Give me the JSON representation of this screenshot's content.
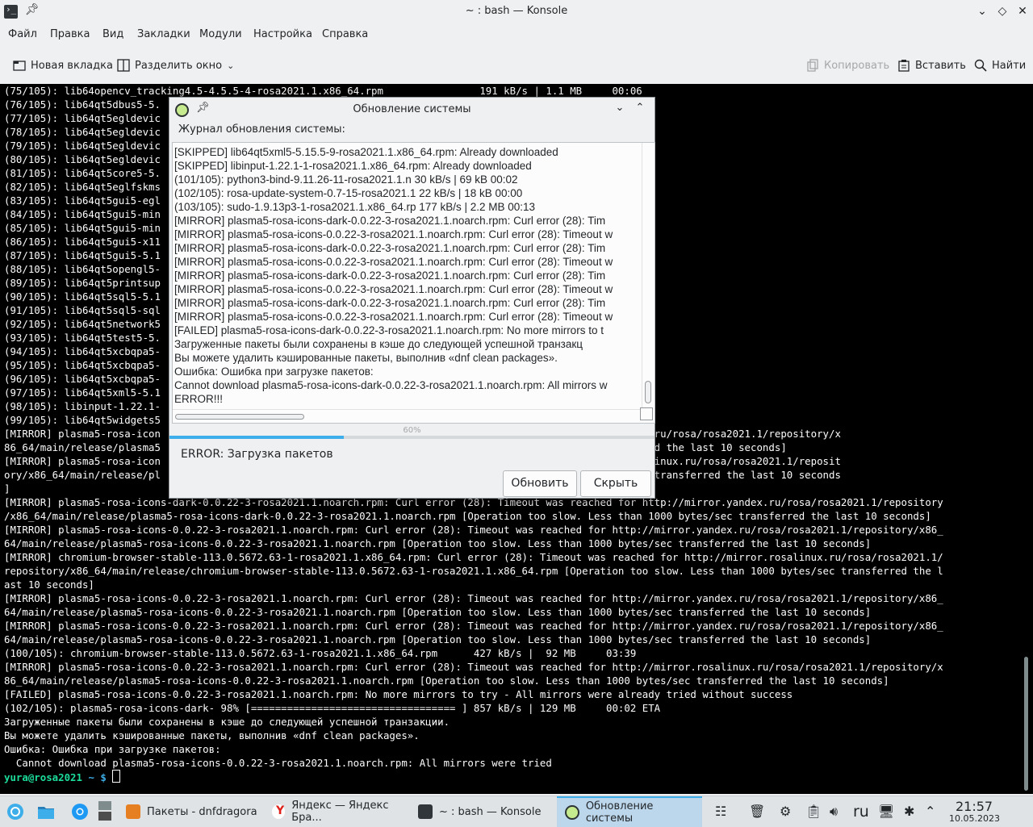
{
  "window": {
    "title": "~ : bash — Konsole",
    "menu": [
      "Файл",
      "Правка",
      "Вид",
      "Закладки",
      "Модули",
      "Настройка",
      "Справка"
    ],
    "toolbar": {
      "new_tab": "Новая вкладка",
      "split": "Разделить окно",
      "copy": "Копировать",
      "paste": "Вставить",
      "find": "Найти"
    }
  },
  "terminal": {
    "lines": [
      "(75/105): lib64opencv_tracking4.5-4.5.5-4-rosa2021.1.x86_64.rpm                191 kB/s | 1.1 MB     00:06",
      "(76/105): lib64qt5dbus5-5.                                                                            00:00",
      "(77/105): lib64qt5egldevic                                                                            00:01",
      "(78/105): lib64qt5egldevic                                                                            00:00",
      "(79/105): lib64qt5egldevic                                                                            00:00",
      "(80/105): lib64qt5egldevic                                                                            00:00",
      "(81/105): lib64qt5core5-5.                                                                            00:04",
      "(82/105): lib64qt5eglfskms                                                                            00:01",
      "(83/105): lib64qt5gui5-egl                                                                            00:00",
      "(84/105): lib64qt5gui5-min                                                                            00:01",
      "(85/105): lib64qt5gui5-min                                                                            00:01",
      "(86/105): lib64qt5gui5-x11                                                                            00:01",
      "(87/105): lib64qt5gui5-5.1                                                                            00:07",
      "(88/105): lib64qt5opengl5-                                                                            00:01",
      "(89/105): lib64qt5printsup                                                                            00:02",
      "(90/105): lib64qt5sql5-5.1                                                                            00:01",
      "(91/105): lib64qt5sql5-sql                                                                            00:00",
      "(92/105): lib64qt5network5                                                                            00:08",
      "(93/105): lib64qt5test5-5.                                                                            00:01",
      "(94/105): lib64qt5xcbqpa5-                                                                            00:02",
      "(95/105): lib64qt5xcbqpa5-                                                                            00:00",
      "(96/105): lib64qt5xcbqpa5-                                                                            00:00",
      "(97/105): lib64qt5xml5-5.1                                                                            00:01",
      "(98/105): libinput-1.22.1-                                                                            00:02",
      "(99/105): lib64qt5widgets5                                                                            00:08",
      "[MIRROR] plasma5-rosa-icon                                                          http://mirror.rosalinux.ru/rosa/rosa2021.1/repository/x",
      "86_64/main/release/plasma5                                                          000 bytes/sec transferred the last 10 seconds]",
      "[MIRROR] plasma5-rosa-icon                                                           for http://mirror.rosalinux.ru/rosa/rosa2021.1/reposit",
      "ory/x86_64/main/release/pl                                                          ess than 1000 bytes/sec transferred the last 10 seconds",
      "]",
      "[MIRROR] plasma5-rosa-icons-dark-0.0.22-3-rosa2021.1.noarch.rpm: Curl error (28): Timeout was reached for http://mirror.yandex.ru/rosa/rosa2021.1/repository",
      "/x86_64/main/release/plasma5-rosa-icons-dark-0.0.22-3-rosa2021.1.noarch.rpm [Operation too slow. Less than 1000 bytes/sec transferred the last 10 seconds]",
      "[MIRROR] plasma5-rosa-icons-0.0.22-3-rosa2021.1.noarch.rpm: Curl error (28): Timeout was reached for http://mirror.yandex.ru/rosa/rosa2021.1/repository/x86_",
      "64/main/release/plasma5-rosa-icons-0.0.22-3-rosa2021.1.noarch.rpm [Operation too slow. Less than 1000 bytes/sec transferred the last 10 seconds]",
      "[MIRROR] chromium-browser-stable-113.0.5672.63-1-rosa2021.1.x86_64.rpm: Curl error (28): Timeout was reached for http://mirror.rosalinux.ru/rosa/rosa2021.1/",
      "repository/x86_64/main/release/chromium-browser-stable-113.0.5672.63-1-rosa2021.1.x86_64.rpm [Operation too slow. Less than 1000 bytes/sec transferred the l",
      "ast 10 seconds]",
      "[MIRROR] plasma5-rosa-icons-0.0.22-3-rosa2021.1.noarch.rpm: Curl error (28): Timeout was reached for http://mirror.yandex.ru/rosa/rosa2021.1/repository/x86_",
      "64/main/release/plasma5-rosa-icons-0.0.22-3-rosa2021.1.noarch.rpm [Operation too slow. Less than 1000 bytes/sec transferred the last 10 seconds]",
      "[MIRROR] plasma5-rosa-icons-0.0.22-3-rosa2021.1.noarch.rpm: Curl error (28): Timeout was reached for http://mirror.yandex.ru/rosa/rosa2021.1/repository/x86_",
      "64/main/release/plasma5-rosa-icons-0.0.22-3-rosa2021.1.noarch.rpm [Operation too slow. Less than 1000 bytes/sec transferred the last 10 seconds]",
      "(100/105): chromium-browser-stable-113.0.5672.63-1-rosa2021.1.x86_64.rpm      427 kB/s |  92 MB     03:39",
      "[MIRROR] plasma5-rosa-icons-0.0.22-3-rosa2021.1.noarch.rpm: Curl error (28): Timeout was reached for http://mirror.rosalinux.ru/rosa/rosa2021.1/repository/x",
      "86_64/main/release/plasma5-rosa-icons-0.0.22-3-rosa2021.1.noarch.rpm [Operation too slow. Less than 1000 bytes/sec transferred the last 10 seconds]",
      "[FAILED] plasma5-rosa-icons-0.0.22-3-rosa2021.1.noarch.rpm: No more mirrors to try - All mirrors were already tried without success",
      "(102/105): plasma5-rosa-icons-dark- 98% [================================== ] 857 kB/s | 129 MB     00:02 ETA",
      "Загруженные пакеты были сохранены в кэше до следующей успешной транзакции.",
      "Вы можете удалить кэшированные пакеты, выполнив «dnf clean packages».",
      "Ошибка: Ошибка при загрузке пакетов:",
      "  Cannot download plasma5-rosa-icons-0.0.22-3-rosa2021.1.noarch.rpm: All mirrors were tried"
    ],
    "prompt_user": "yura@rosa2021",
    "prompt_path": " ~ ",
    "prompt_sym": "$ "
  },
  "dialog": {
    "title": "Обновление системы",
    "log_label": "Журнал обновления системы:",
    "log_lines": [
      "[SKIPPED] lib64qt5xml5-5.15.5-9-rosa2021.1.x86_64.rpm: Already downloaded",
      "[SKIPPED] libinput-1.22.1-1-rosa2021.1.x86_64.rpm: Already downloaded",
      "(101/105): python3-bind-9.11.26-11-rosa2021.1.n  30 kB/s |  69 kB     00:02",
      "(102/105): rosa-update-system-0.7-15-rosa2021.1  22 kB/s |  18 kB     00:00",
      "(103/105): sudo-1.9.13p3-1-rosa2021.1.x86_64.rp 177 kB/s | 2.2 MB     00:13",
      "[MIRROR] plasma5-rosa-icons-dark-0.0.22-3-rosa2021.1.noarch.rpm: Curl error (28): Tim",
      "[MIRROR] plasma5-rosa-icons-0.0.22-3-rosa2021.1.noarch.rpm: Curl error (28): Timeout w",
      "[MIRROR] plasma5-rosa-icons-dark-0.0.22-3-rosa2021.1.noarch.rpm: Curl error (28): Tim",
      "[MIRROR] plasma5-rosa-icons-0.0.22-3-rosa2021.1.noarch.rpm: Curl error (28): Timeout w",
      "[MIRROR] plasma5-rosa-icons-dark-0.0.22-3-rosa2021.1.noarch.rpm: Curl error (28): Tim",
      "[MIRROR] plasma5-rosa-icons-0.0.22-3-rosa2021.1.noarch.rpm: Curl error (28): Timeout w",
      "[MIRROR] plasma5-rosa-icons-dark-0.0.22-3-rosa2021.1.noarch.rpm: Curl error (28): Tim",
      "[MIRROR] plasma5-rosa-icons-0.0.22-3-rosa2021.1.noarch.rpm: Curl error (28): Timeout w",
      "[FAILED] plasma5-rosa-icons-dark-0.0.22-3-rosa2021.1.noarch.rpm: No more mirrors to t",
      "Загруженные пакеты были сохранены в кэше до следующей успешной транзакц",
      "Вы можете удалить кэшированные пакеты, выполнив «dnf clean packages».",
      "Ошибка: Ошибка при загрузке пакетов:",
      "Cannot download plasma5-rosa-icons-dark-0.0.22-3-rosa2021.1.noarch.rpm: All mirrors w",
      "ERROR!!!"
    ],
    "progress_label": "60%",
    "progress_value": 0.6,
    "error_text": "ERROR: Загрузка пакетов",
    "update_button": "Обновить",
    "hide_button": "Скрыть"
  },
  "taskbar": {
    "tasks": [
      {
        "label": "Пакеты - dnfdragora"
      },
      {
        "label": "Яндекс — Яндекс Бра..."
      },
      {
        "label": "~ : bash — Konsole"
      },
      {
        "label": "Обновление системы"
      }
    ],
    "lang": "ru",
    "time": "21:57",
    "date": "10.05.2023"
  }
}
